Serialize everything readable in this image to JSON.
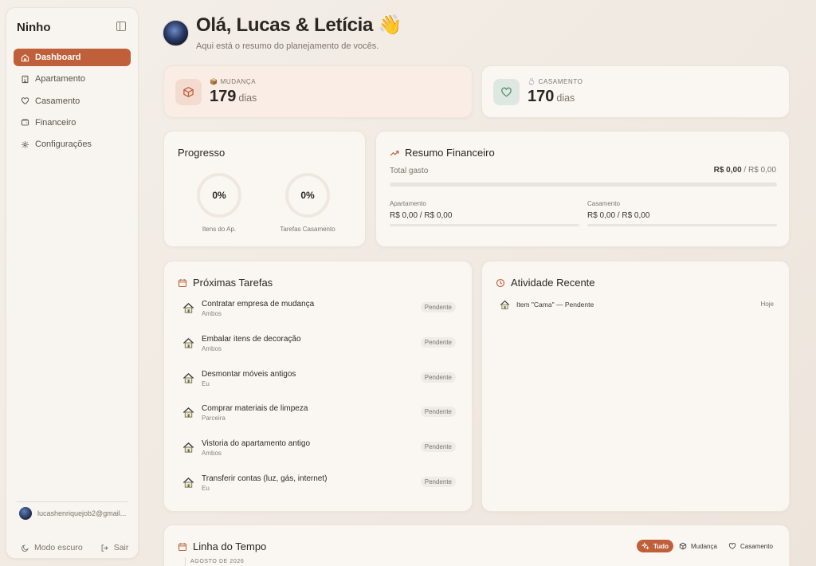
{
  "sidebar": {
    "brand": "Ninho",
    "nav": [
      {
        "label": "Dashboard",
        "icon": "home-icon",
        "active": true
      },
      {
        "label": "Apartamento",
        "icon": "building-icon"
      },
      {
        "label": "Casamento",
        "icon": "heart-icon"
      },
      {
        "label": "Financeiro",
        "icon": "wallet-icon"
      },
      {
        "label": "Configurações",
        "icon": "gear-icon"
      }
    ],
    "user_email": "lucashenriquejob2@gmail...",
    "dark_mode_label": "Modo escuro",
    "logout_label": "Sair"
  },
  "header": {
    "greeting": "Olá, Lucas & Letícia 👋",
    "subtitle": "Aqui está o resumo do planejamento de vocês."
  },
  "countdowns": {
    "mudanca": {
      "emoji": "📦",
      "label": "MUDANÇA",
      "value": "179",
      "unit": "dias",
      "accent": "#c0603b"
    },
    "casamento": {
      "emoji": "💍",
      "label": "CASAMENTO",
      "value": "170",
      "unit": "dias",
      "accent": "#5f8a70"
    }
  },
  "progress": {
    "title": "Progresso",
    "items": [
      {
        "label": "Itens do Ap.",
        "value": "0%",
        "fraction": 0
      },
      {
        "label": "Tarefas Casamento",
        "value": "0%",
        "fraction": 0
      }
    ]
  },
  "finance": {
    "title": "Resumo Financeiro",
    "total_label": "Total gasto",
    "total_spent": "R$ 0,00",
    "total_budget": " / R$ 0,00",
    "total_fraction": 0,
    "apartamento": {
      "label": "Apartamento",
      "value": "R$ 0,00 / R$ 0,00",
      "fraction": 0
    },
    "casamento": {
      "label": "Casamento",
      "value": "R$ 0,00 / R$ 0,00",
      "fraction": 0
    }
  },
  "tasks": {
    "title": "Próximas Tarefas",
    "items": [
      {
        "title": "Contratar empresa de mudança",
        "owner": "Ambos",
        "status": "Pendente"
      },
      {
        "title": "Embalar itens de decoração",
        "owner": "Ambos",
        "status": "Pendente"
      },
      {
        "title": "Desmontar móveis antigos",
        "owner": "Eu",
        "status": "Pendente"
      },
      {
        "title": "Comprar materiais de limpeza",
        "owner": "Parceira",
        "status": "Pendente"
      },
      {
        "title": "Vistoria do apartamento antigo",
        "owner": "Ambos",
        "status": "Pendente"
      },
      {
        "title": "Transferir contas (luz, gás, internet)",
        "owner": "Eu",
        "status": "Pendente"
      }
    ]
  },
  "activity": {
    "title": "Atividade Recente",
    "items": [
      {
        "text": "Item \"Cama\" — Pendente",
        "time": "Hoje"
      }
    ]
  },
  "timeline": {
    "title": "Linha do Tempo",
    "filters": [
      {
        "label": "Tudo",
        "icon": "sparkles-icon",
        "active": true
      },
      {
        "label": "Mudança",
        "icon": "box-icon"
      },
      {
        "label": "Casamento",
        "icon": "heart-icon"
      }
    ],
    "month": "AGOSTO DE 2026"
  },
  "colors": {
    "accent": "#c0603b",
    "green": "#5f8a70",
    "background": "#f2ece5"
  }
}
